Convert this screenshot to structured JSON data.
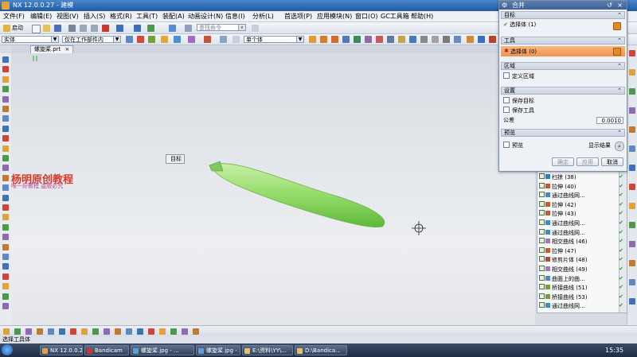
{
  "window": {
    "title": "NX 12.0.0.27 - 建模"
  },
  "menu": [
    "文件(F)",
    "编辑(E)",
    "视图(V)",
    "插入(S)",
    "格式(R)",
    "工具(T)",
    "装配(A)",
    "动画设计(N)",
    "信息(I)",
    "分析(L)",
    "首选项(P)",
    "应用模块(N)",
    "窗口(O)",
    "GC工具箱",
    "帮助(H)"
  ],
  "toolbar": {
    "start_label": "启动",
    "filter_value": "实体",
    "assembly_scope_value": "仅在工作部件内",
    "command_finder_placeholder": "查找命令",
    "snap_value": "单个体"
  },
  "file_tab": {
    "label": "螺旋桨.prt"
  },
  "graphics": {
    "target_tooltip": "目标",
    "part_label": "杨明原创教程",
    "watermark_sub": "唯一好教程 盗版必究"
  },
  "dialog": {
    "title": "合并",
    "sections": {
      "target": "目标",
      "target_row": "选择体 (1)",
      "tool": "工具",
      "tool_row": "选择体 (0)",
      "region": "区域",
      "region_row": "定义区域",
      "settings": "设置",
      "keep_target": "保存目标",
      "keep_tool": "保存工具",
      "tolerance_label": "公差",
      "tolerance_value": "0.0010",
      "preview": "预览",
      "preview_row": "预览",
      "show_result": "显示结果"
    },
    "buttons": {
      "ok": "确定",
      "apply": "应用",
      "cancel": "取消"
    }
  },
  "tree": {
    "items": [
      "扫掠 (38)",
      "拉伸 (40)",
      "通过曲线网...",
      "拉伸 (42)",
      "拉伸 (43)",
      "通过曲线网...",
      "通过曲线网...",
      "相交曲线 (46)",
      "拉伸 (47)",
      "修剪片体 (48)",
      "相交曲线 (49)",
      "曲面上的曲...",
      "桥接曲线 (51)",
      "桥接曲线 (53)",
      "通过曲线网..."
    ]
  },
  "status": {
    "text": "选择工具体"
  },
  "taskbar": {
    "items": [
      "NX 12.0.0.2...",
      "Bandicam",
      "螺旋桨.jpg - ...",
      "螺旋桨.jpg - ...",
      "E:\\资料\\YY\\...",
      "D:\\Bandica..."
    ],
    "clock": "15:35"
  },
  "colors": {
    "accent": "#3e6297",
    "tool_highlight": "#f3a05a",
    "blade": "#9ede74",
    "watermark": "#d63a2c"
  },
  "icons": {
    "crosshair": "crosshair-icon",
    "orientation": "orientation-icon"
  }
}
